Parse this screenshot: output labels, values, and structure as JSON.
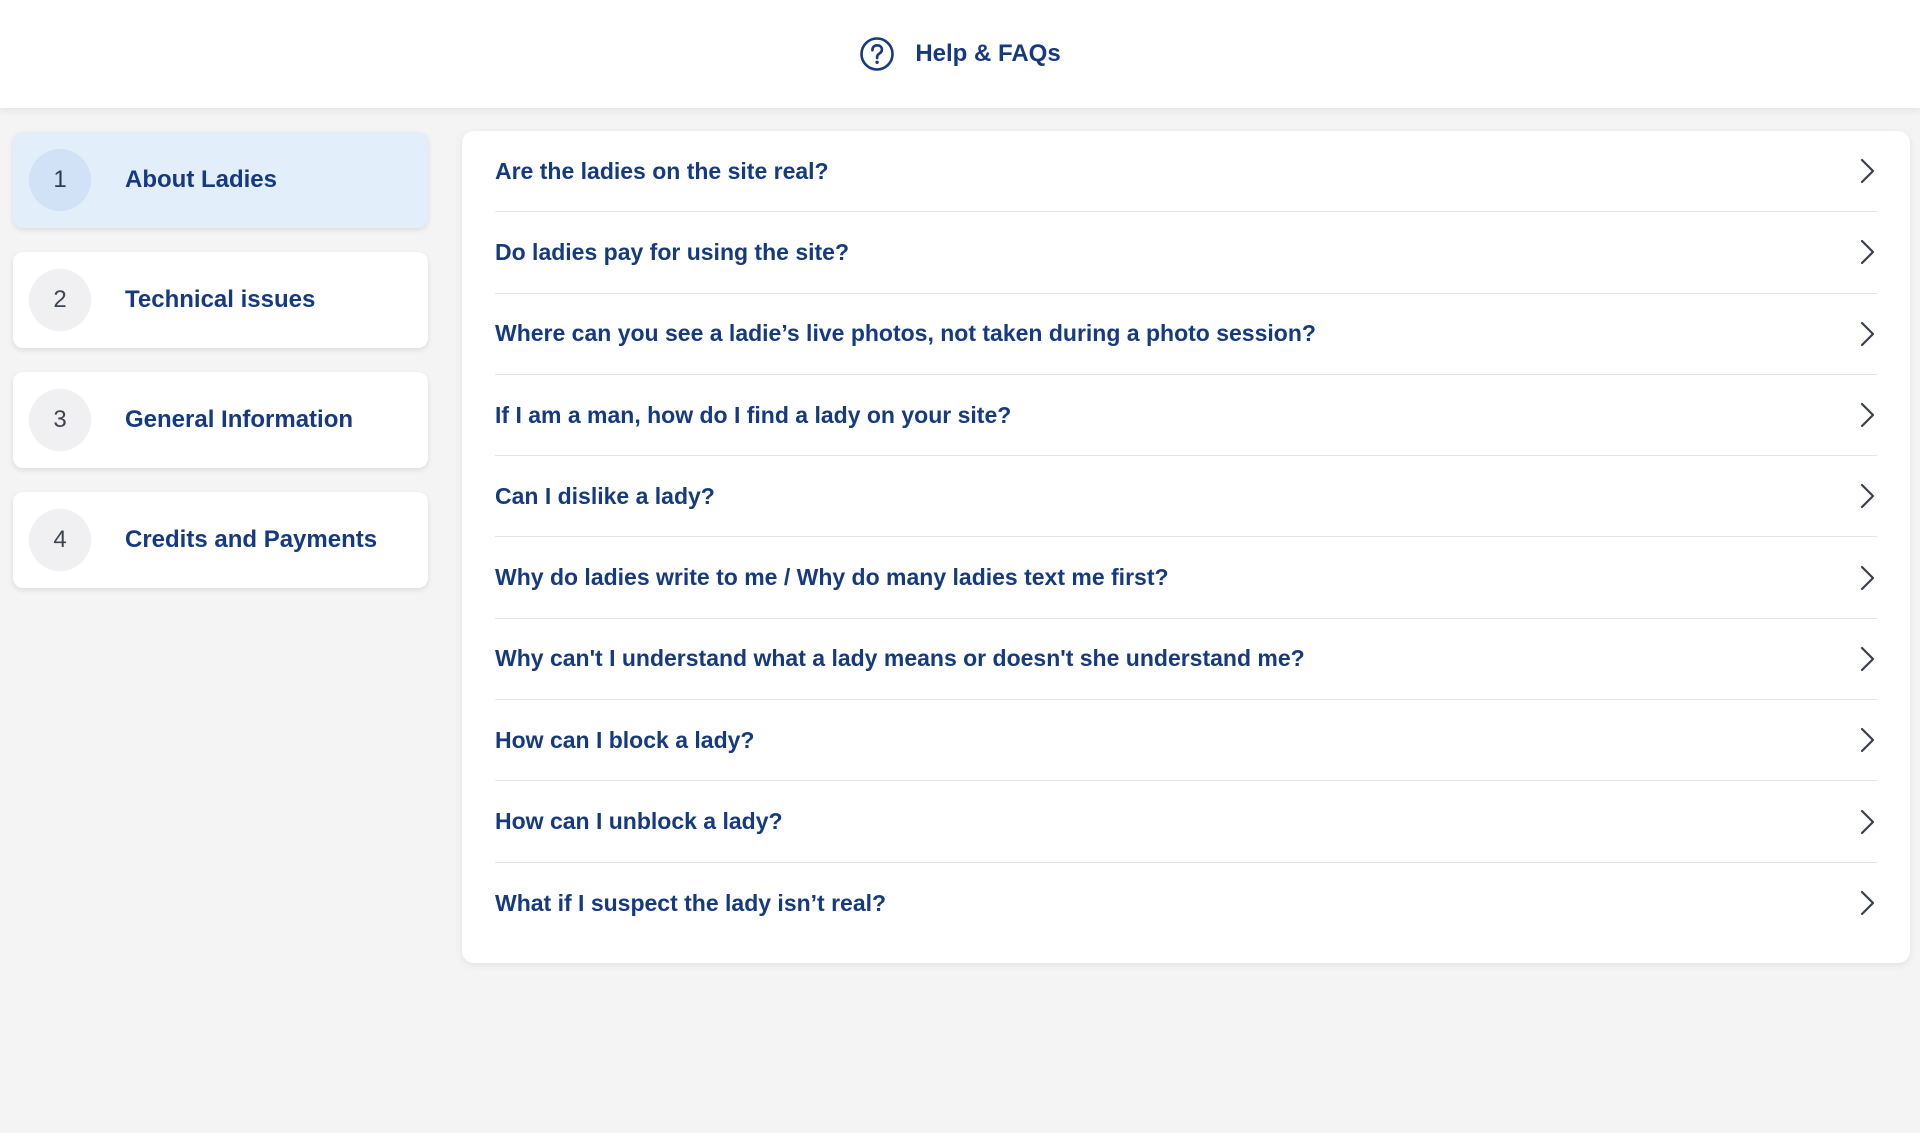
{
  "header": {
    "title": "Help & FAQs",
    "icon": "question-circle-icon"
  },
  "categories": [
    {
      "number": "1",
      "label": "About Ladies",
      "active": true
    },
    {
      "number": "2",
      "label": "Technical issues",
      "active": false
    },
    {
      "number": "3",
      "label": "General Information",
      "active": false
    },
    {
      "number": "4",
      "label": "Credits and Payments",
      "active": false
    }
  ],
  "faqs": [
    {
      "question": "Are the ladies on the site real?"
    },
    {
      "question": "Do ladies pay for using the site?"
    },
    {
      "question": "Where can you see a ladie’s live photos, not taken during a photo session?"
    },
    {
      "question": "If I am a man, how do I find a lady on your site?"
    },
    {
      "question": "Can I dislike a lady?"
    },
    {
      "question": "Why do ladies write to me / Why do many ladies text me first?"
    },
    {
      "question": "Why can't I understand what a lady means or doesn't she understand me?"
    },
    {
      "question": "How can I block a lady?"
    },
    {
      "question": "How can I unblock a lady?"
    },
    {
      "question": "What if I suspect the lady isn’t real?"
    }
  ],
  "colors": {
    "accent": "#163a80",
    "active_category_bg": "#e3eefb",
    "page_bg": "#f4f4f5"
  }
}
